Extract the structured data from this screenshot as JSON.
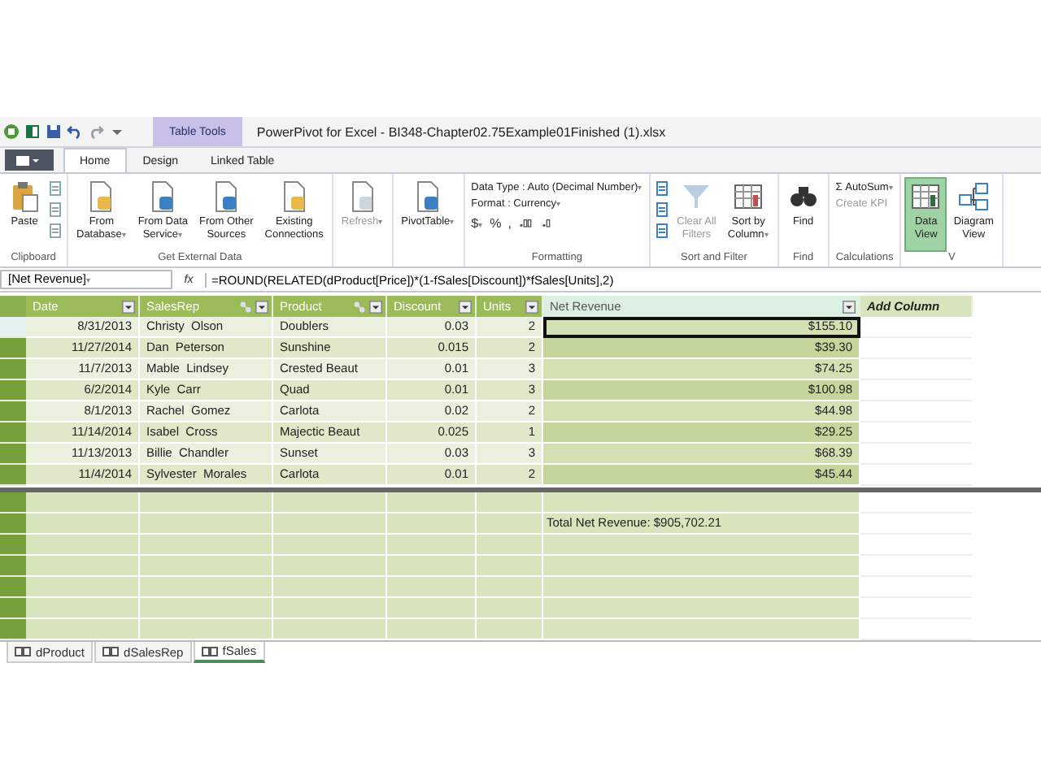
{
  "window": {
    "title": "PowerPivot for Excel - BI348-Chapter02.75Example01Finished (1).xlsx",
    "contextual_tab": "Table Tools"
  },
  "ribbon_tabs": [
    {
      "label": "Home",
      "selected": true
    },
    {
      "label": "Design",
      "selected": false
    },
    {
      "label": "Linked Table",
      "selected": false
    }
  ],
  "ribbon_groups": [
    {
      "label": "Clipboard",
      "items": [
        {
          "kind": "large",
          "lines": [
            "Paste"
          ],
          "disabled": false
        },
        {
          "kind": "smallstack"
        }
      ]
    },
    {
      "label": "Get External Data",
      "items": [
        {
          "kind": "large",
          "lines": [
            "From",
            "Database"
          ],
          "disabled": false,
          "caret": "▾"
        },
        {
          "kind": "large",
          "lines": [
            "From Data",
            "Service"
          ],
          "disabled": false,
          "caret": "▾"
        },
        {
          "kind": "large",
          "lines": [
            "From Other",
            "Sources"
          ],
          "disabled": false
        },
        {
          "kind": "large",
          "lines": [
            "Existing",
            "Connections"
          ],
          "disabled": false
        }
      ]
    },
    {
      "items": [
        {
          "kind": "large",
          "lines": [
            "Refresh"
          ],
          "disabled": true,
          "caret": "▾"
        }
      ]
    },
    {
      "items": [
        {
          "kind": "large",
          "lines": [
            "PivotTable"
          ],
          "disabled": false,
          "caret": "▾"
        }
      ]
    },
    {
      "label": "Formatting",
      "items": [
        {
          "kind": "formatting",
          "data_type": "Data Type : Auto (Decimal Number)",
          "data_type_caret": "▾",
          "format": "Format : Currency",
          "format_caret": "▾",
          "symbols": [
            {
              "label": "$",
              "caret": "▾"
            },
            {
              "label": "%"
            },
            {
              "label": ","
            }
          ]
        }
      ]
    },
    {
      "label": "Sort and Filter",
      "items": [
        {
          "kind": "smallstack"
        },
        {
          "kind": "large",
          "lines": [
            "Clear All",
            "Filters"
          ],
          "disabled": true
        },
        {
          "kind": "large",
          "lines": [
            "Sort by",
            "Column"
          ],
          "disabled": false,
          "caret": "▾"
        }
      ]
    },
    {
      "label": "Find",
      "items": [
        {
          "kind": "large",
          "lines": [
            "Find"
          ],
          "disabled": false
        }
      ]
    },
    {
      "label": "Calculations",
      "items": [
        {
          "kind": "calc",
          "autosum_glyph": "Σ",
          "autosum": "AutoSum",
          "autosum_caret": "▾",
          "kpi": "Create KPI",
          "kpi_disabled": true
        }
      ]
    },
    {
      "label": "V",
      "items": [
        {
          "kind": "large",
          "lines": [
            "Data",
            "View"
          ],
          "disabled": false,
          "selected": true
        },
        {
          "kind": "large",
          "lines": [
            "Diagram",
            "View"
          ],
          "disabled": false,
          "selected": false
        }
      ]
    }
  ],
  "formula_bar": {
    "name_box": "[Net Revenue]",
    "name_box_caret": "▾",
    "fx": "fx",
    "formula": "=ROUND(RELATED(dProduct[Price])*(1-fSales[Discount])*fSales[Units],2)"
  },
  "table": {
    "columns": [
      {
        "label": "Date",
        "kind": "date",
        "related": false,
        "selected": false
      },
      {
        "label": "SalesRep",
        "kind": "text",
        "related": true,
        "selected": false
      },
      {
        "label": "Product",
        "kind": "text",
        "related": true,
        "selected": false
      },
      {
        "label": "Discount",
        "kind": "number",
        "related": false,
        "selected": false
      },
      {
        "label": "Units",
        "kind": "number",
        "related": false,
        "selected": false
      },
      {
        "label": "Net Revenue",
        "kind": "calc",
        "related": false,
        "selected": true
      },
      {
        "label": "Add Column",
        "kind": "add",
        "related": false,
        "selected": false
      }
    ],
    "rows": [
      {
        "selected": true,
        "cells": [
          "8/31/2013",
          "Christy  Olson",
          "Doublers",
          "0.03",
          "2",
          "$155.10"
        ]
      },
      {
        "selected": false,
        "cells": [
          "11/27/2014",
          "Dan  Peterson",
          "Sunshine",
          "0.015",
          "2",
          "$39.30"
        ]
      },
      {
        "selected": false,
        "cells": [
          "11/7/2013",
          "Mable  Lindsey",
          "Crested Beaut",
          "0.01",
          "3",
          "$74.25"
        ]
      },
      {
        "selected": false,
        "cells": [
          "6/2/2014",
          "Kyle  Carr",
          "Quad",
          "0.01",
          "3",
          "$100.98"
        ]
      },
      {
        "selected": false,
        "cells": [
          "8/1/2013",
          "Rachel  Gomez",
          "Carlota",
          "0.02",
          "2",
          "$44.98"
        ]
      },
      {
        "selected": false,
        "cells": [
          "11/14/2014",
          "Isabel  Cross",
          "Majectic Beaut",
          "0.025",
          "1",
          "$29.25"
        ]
      },
      {
        "selected": false,
        "cells": [
          "11/13/2013",
          "Billie  Chandler",
          "Sunset",
          "0.03",
          "3",
          "$68.39"
        ]
      },
      {
        "selected": false,
        "cells": [
          "11/4/2014",
          "Sylvester  Morales",
          "Carlota",
          "0.01",
          "2",
          "$45.44"
        ]
      }
    ],
    "measure_rows": [
      [
        null,
        null,
        null,
        null,
        null,
        null
      ],
      [
        null,
        null,
        null,
        null,
        null,
        "Total Net Revenue: $905,702.21"
      ],
      [
        null,
        null,
        null,
        null,
        null,
        null
      ],
      [
        null,
        null,
        null,
        null,
        null,
        null
      ],
      [
        null,
        null,
        null,
        null,
        null,
        null
      ],
      [
        null,
        null,
        null,
        null,
        null,
        null
      ],
      [
        null,
        null,
        null,
        null,
        null,
        null
      ]
    ]
  },
  "sheet_tabs": [
    {
      "label": "dProduct",
      "selected": false
    },
    {
      "label": "dSalesRep",
      "selected": false
    },
    {
      "label": "fSales",
      "selected": true
    }
  ]
}
